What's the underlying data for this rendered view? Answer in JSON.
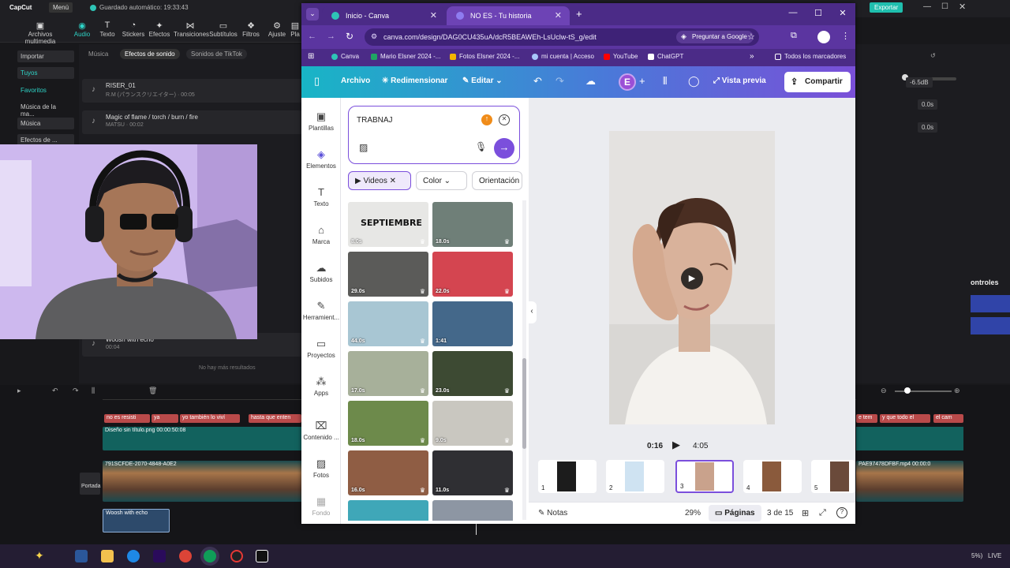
{
  "capcut": {
    "app_name": "CapCut",
    "menu_label": "Menú",
    "autosave": "Guardado automático: 19:33:43",
    "export_label": "Exportar",
    "toolbar": [
      "Archivos multimedia",
      "Audio",
      "Texto",
      "Stickers",
      "Efectos",
      "Transiciones",
      "Subtítulos",
      "Filtros",
      "Ajuste",
      "Pla"
    ],
    "side": [
      "Importar",
      "Tuyos",
      "Favoritos",
      "Música de la ma...",
      "Música",
      "Efectos de ..."
    ],
    "list_tabs": [
      "Música",
      "Efectos de sonido",
      "Sonidos de TikTok"
    ],
    "items": [
      {
        "title": "RISER_01",
        "sub": "R.M (パランスクリエイター) · 00:05"
      },
      {
        "title": "Magic of flame / torch / burn / fire",
        "sub": "MATSU · 00:02"
      },
      {
        "title": "Woosh with echo",
        "sub": "00:04"
      }
    ],
    "list_end": "No hay más resultados",
    "props": [
      "-6.5dB",
      "0.0s",
      "0.0s"
    ],
    "controls_label": "ontroles",
    "timeline": {
      "caption_clips": [
        "no es resisti",
        "ya",
        "yo también lo viví",
        "hasta que enten",
        "e tem",
        "y que todo el",
        "el cam"
      ],
      "image_clip": "Diseño sin título.png  00:00:50:08",
      "video_clip": "791SCFDE-2070-4848-A0E2",
      "video_clip_right": "PAE97478DFBF.mp4  00:00:0",
      "cover_label": "Portada",
      "audio_clip": "Woosh with echo"
    }
  },
  "chrome": {
    "tabs": [
      {
        "title": "Inicio - Canva"
      },
      {
        "title": "NO ES - Tu historia"
      }
    ],
    "url": "canva.com/design/DAG0CU435uA/dcR5BEAWEh-LsUclw-tS_g/edit",
    "ask_google": "Preguntar a Google",
    "bookmarks": [
      "Canva",
      "Mario Elsner 2024 -...",
      "Fotos Elsner 2024 -...",
      "mi cuenta | Acceso",
      "YouTube",
      "ChatGPT"
    ],
    "all_bookmarks": "Todos los marcadores"
  },
  "canva": {
    "topbar": {
      "file": "Archivo",
      "resize": "Redimensionar",
      "edit": "Editar",
      "avatar": "E",
      "preview": "Vista previa",
      "share": "Compartir"
    },
    "rail": [
      "Plantillas",
      "Elementos",
      "Texto",
      "Marca",
      "Subidos",
      "Herramient...",
      "Proyectos",
      "Apps",
      "Contenido ...",
      "Fotos",
      "Fondo"
    ],
    "search": {
      "value": "TRABNAJ"
    },
    "chips": [
      "Videos",
      "Color",
      "Orientación"
    ],
    "thumbnail_text": "SEPTIEMBRE",
    "thumbs": [
      {
        "dur": "8.0s",
        "color": "#e7e7e5"
      },
      {
        "dur": "18.0s",
        "color": "#6f7f78"
      },
      {
        "dur": "29.0s",
        "color": "#5b5b59"
      },
      {
        "dur": "22.0s",
        "color": "#d44550"
      },
      {
        "dur": "44.0s",
        "color": "#a8c6d3"
      },
      {
        "dur": "1:41",
        "color": "#44688a"
      },
      {
        "dur": "17.0s",
        "color": "#a7b09a"
      },
      {
        "dur": "23.0s",
        "color": "#3d4a33"
      },
      {
        "dur": "18.0s",
        "color": "#6d8a4b"
      },
      {
        "dur": "9.0s",
        "color": "#c9c7c0"
      },
      {
        "dur": "16.0s",
        "color": "#8f5d44"
      },
      {
        "dur": "11.0s",
        "color": "#2f2f33"
      },
      {
        "dur": "",
        "color": "#3fa7b8"
      },
      {
        "dur": "",
        "color": "#8d96a3"
      }
    ],
    "playback": {
      "current": "0:16",
      "total": "4:05"
    },
    "pages": [
      "1",
      "2",
      "3",
      "4",
      "5"
    ],
    "footer": {
      "notes": "Notas",
      "zoom": "29%",
      "pages_label": "Páginas",
      "page_counter": "3 de 15"
    },
    "accent": "#7b4fdc"
  },
  "taskbar": {
    "right_text": "5%)",
    "live": "LIVE"
  }
}
